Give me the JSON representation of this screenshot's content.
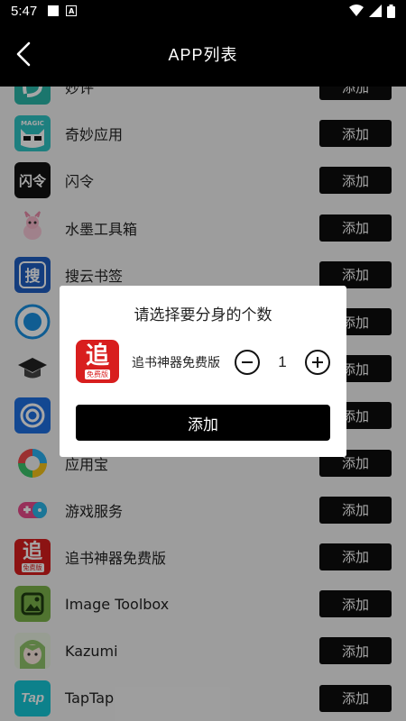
{
  "status": {
    "time": "5:47"
  },
  "appbar": {
    "title": "APP列表"
  },
  "apps": [
    {
      "name": "妙评",
      "button": "添加"
    },
    {
      "name": "奇妙应用",
      "button": "添加",
      "icon_text": "MAGIC"
    },
    {
      "name": "闪令",
      "button": "添加",
      "icon_text": "闪令"
    },
    {
      "name": "水墨工具箱",
      "button": "添加"
    },
    {
      "name": "搜云书签",
      "button": "添加",
      "icon_text": "搜"
    },
    {
      "name": "",
      "button": "添加"
    },
    {
      "name": "",
      "button": "添加"
    },
    {
      "name": "",
      "button": "添加"
    },
    {
      "name": "应用宝",
      "button": "添加"
    },
    {
      "name": "游戏服务",
      "button": "添加"
    },
    {
      "name": "追书神器免费版",
      "button": "添加",
      "icon_text": "追",
      "icon_sub": "免费版"
    },
    {
      "name": "Image Toolbox",
      "button": "添加"
    },
    {
      "name": "Kazumi",
      "button": "添加"
    },
    {
      "name": "TapTap",
      "button": "添加",
      "icon_text": "Tap"
    }
  ],
  "dialog": {
    "title": "请选择要分身的个数",
    "app_name": "追书神器免费版",
    "icon_text": "追",
    "icon_sub": "免费版",
    "count": "1",
    "add_label": "添加"
  },
  "colors": {
    "accent": "#000000",
    "zhuishu_red": "#d81e1e",
    "taptap": "#14c6d6",
    "image_toolbox": "#7bb34a"
  }
}
